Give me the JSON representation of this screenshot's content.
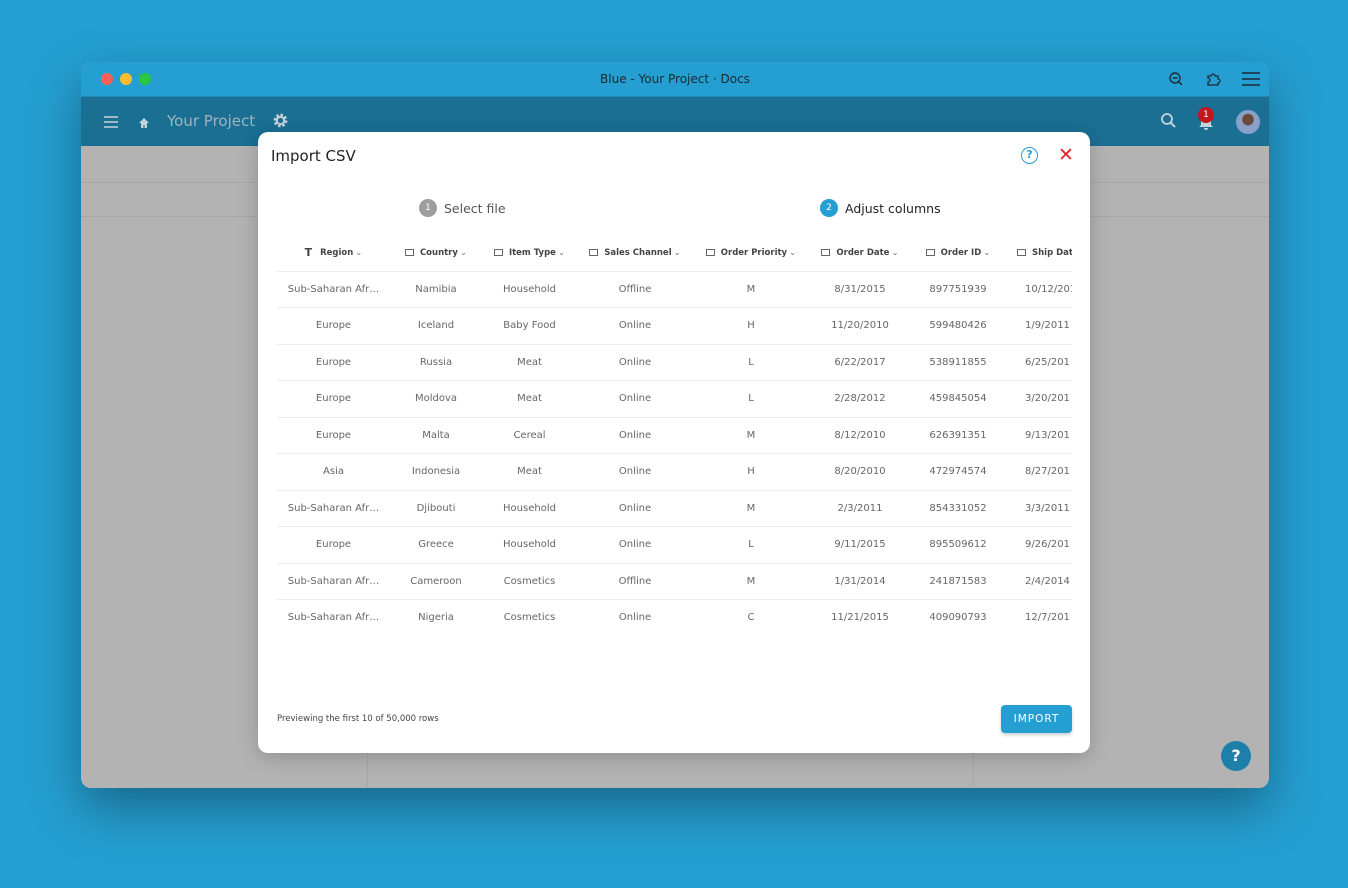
{
  "window": {
    "title": "Blue - Your Project · Docs"
  },
  "appbar": {
    "project": "Your Project",
    "notification_count": "1"
  },
  "modal": {
    "title": "Import CSV",
    "steps": [
      {
        "num": "1",
        "label": "Select file",
        "active": false
      },
      {
        "num": "2",
        "label": "Adjust columns",
        "active": true
      }
    ],
    "columns": [
      "Region",
      "Country",
      "Item Type",
      "Sales Channel",
      "Order Priority",
      "Order Date",
      "Order ID",
      "Ship Dat"
    ],
    "column_icons": [
      "text-type-icon",
      "field-icon",
      "field-icon",
      "field-icon",
      "field-icon",
      "field-icon",
      "field-icon",
      "field-icon"
    ],
    "rows": [
      [
        "Sub-Saharan Afr…",
        "Namibia",
        "Household",
        "Offline",
        "M",
        "8/31/2015",
        "897751939",
        "10/12/201"
      ],
      [
        "Europe",
        "Iceland",
        "Baby Food",
        "Online",
        "H",
        "11/20/2010",
        "599480426",
        "1/9/2011"
      ],
      [
        "Europe",
        "Russia",
        "Meat",
        "Online",
        "L",
        "6/22/2017",
        "538911855",
        "6/25/201"
      ],
      [
        "Europe",
        "Moldova",
        "Meat",
        "Online",
        "L",
        "2/28/2012",
        "459845054",
        "3/20/201"
      ],
      [
        "Europe",
        "Malta",
        "Cereal",
        "Online",
        "M",
        "8/12/2010",
        "626391351",
        "9/13/201"
      ],
      [
        "Asia",
        "Indonesia",
        "Meat",
        "Online",
        "H",
        "8/20/2010",
        "472974574",
        "8/27/201"
      ],
      [
        "Sub-Saharan Afr…",
        "Djibouti",
        "Household",
        "Online",
        "M",
        "2/3/2011",
        "854331052",
        "3/3/2011"
      ],
      [
        "Europe",
        "Greece",
        "Household",
        "Online",
        "L",
        "9/11/2015",
        "895509612",
        "9/26/201"
      ],
      [
        "Sub-Saharan Afr…",
        "Cameroon",
        "Cosmetics",
        "Offline",
        "M",
        "1/31/2014",
        "241871583",
        "2/4/2014"
      ],
      [
        "Sub-Saharan Afr…",
        "Nigeria",
        "Cosmetics",
        "Online",
        "C",
        "11/21/2015",
        "409090793",
        "12/7/201"
      ]
    ],
    "footer": "Previewing the first 10 of 50,000 rows",
    "import_label": "IMPORT"
  },
  "fab_label": "?",
  "colors": {
    "accent": "#259fd2",
    "appbar": "#1a6f93",
    "close": "#e5202a",
    "badge": "#c3171d"
  }
}
